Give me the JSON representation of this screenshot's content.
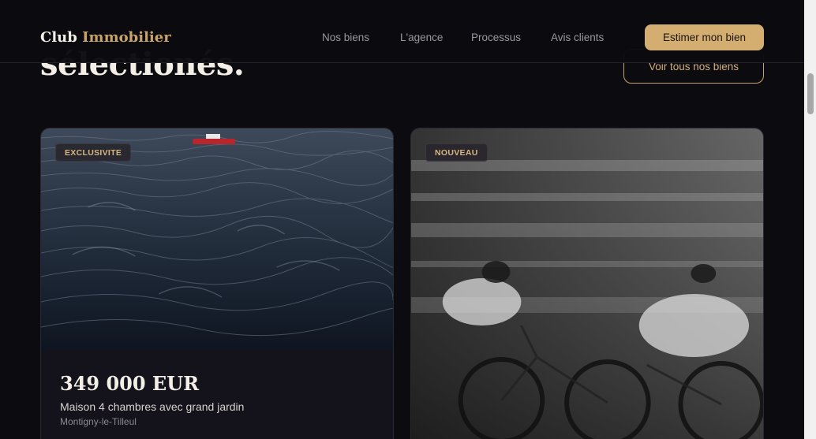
{
  "header": {
    "logo_part1": "Club",
    "logo_part2": "Immobilier",
    "nav": [
      "Nos biens",
      "L'agence",
      "Processus",
      "Avis clients"
    ],
    "cta_label": "Estimer mon bien"
  },
  "section": {
    "title": "sélectionés.",
    "view_all_label": "Voir tous nos biens"
  },
  "cards": [
    {
      "badge": "EXCLUSIVITE",
      "image": "sea-waves-photo",
      "price": "349 000 EUR",
      "description": "Maison 4 chambres avec grand jardin",
      "location": "Montigny-le-Tilleul"
    },
    {
      "badge": "NOUVEAU",
      "image": "cyclists-motion-photo"
    }
  ],
  "colors": {
    "background": "#0c0b10",
    "accent": "#d4ad71",
    "card_background": "#14131c"
  }
}
